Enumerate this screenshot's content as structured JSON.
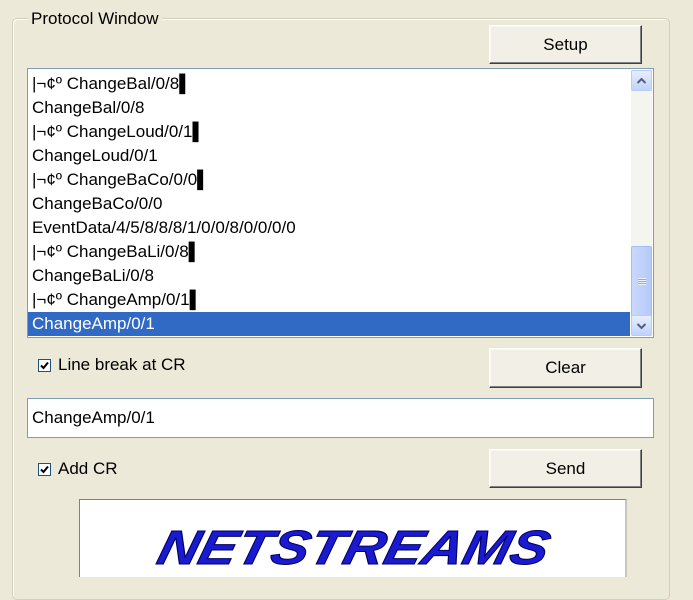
{
  "protocol_window": {
    "title": "Protocol Window",
    "setup_label": "Setup",
    "log_lines": [
      "|¬¢º ChangeBal/0/8▌",
      "ChangeBal/0/8",
      "|¬¢º ChangeLoud/0/1▌",
      "ChangeLoud/0/1",
      "|¬¢º ChangeBaCo/0/0▌",
      "ChangeBaCo/0/0",
      "EventData/4/5/8/8/8/1/0/0/8/0/0/0/0",
      "|¬¢º ChangeBaLi/0/8▌",
      "ChangeBaLi/0/8",
      "|¬¢º ChangeAmp/0/1▌",
      "ChangeAmp/0/1"
    ],
    "selected_index": 10,
    "line_break_label": "Line break at CR",
    "line_break_checked": true,
    "clear_label": "Clear",
    "command_value": "ChangeAmp/0/1",
    "add_cr_label": "Add CR",
    "add_cr_checked": true,
    "send_label": "Send"
  },
  "logo": {
    "text": "NETSTREAMS",
    "color": "#1a1ad0"
  }
}
